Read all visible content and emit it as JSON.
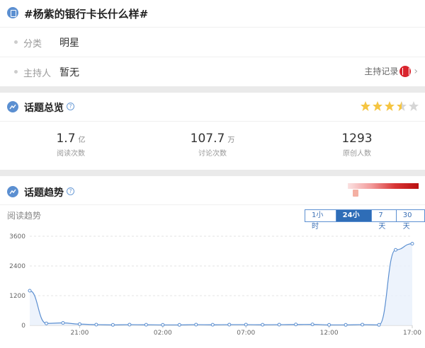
{
  "header": {
    "title": "#杨紫的银行卡长什么样#"
  },
  "info": {
    "category_label": "分类",
    "category_value": "明星",
    "host_label": "主持人",
    "host_value": "暂无",
    "host_record_label": "主持记录"
  },
  "overview": {
    "title": "话题总览",
    "rating": 3.5,
    "stats": [
      {
        "num": "1.7",
        "unit": "亿",
        "label": "阅读次数"
      },
      {
        "num": "107.7",
        "unit": "万",
        "label": "讨论次数"
      },
      {
        "num": "1293",
        "unit": "",
        "label": "原创人数"
      }
    ]
  },
  "trend": {
    "title": "话题趋势",
    "chart_label": "阅读趋势",
    "tabs": [
      {
        "label": "1小时",
        "active": false
      },
      {
        "label": "24小时",
        "active": true
      },
      {
        "label": "7天",
        "active": false
      },
      {
        "label": "30天",
        "active": false
      }
    ],
    "heat_colors": [
      "#fbe2e2",
      "#b90f0f"
    ]
  },
  "chart_data": {
    "type": "area",
    "ylim": [
      0,
      3600
    ],
    "yticks": [
      "0",
      "1200",
      "2400",
      "3600"
    ],
    "xtick_labels": [
      "21:00",
      "02:00",
      "07:00",
      "12:00",
      "17:00"
    ],
    "xtick_index": [
      3,
      8,
      13,
      18,
      23
    ],
    "values": [
      1400,
      80,
      100,
      50,
      30,
      20,
      30,
      25,
      20,
      20,
      30,
      25,
      30,
      30,
      25,
      30,
      35,
      40,
      20,
      20,
      30,
      20,
      3050,
      3300
    ],
    "color": "#5b8fd1"
  }
}
